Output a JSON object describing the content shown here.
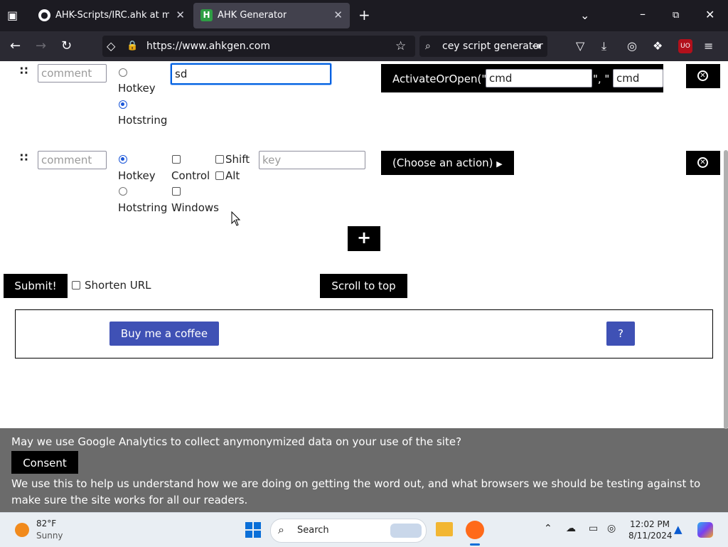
{
  "browser": {
    "tabs": [
      {
        "title": "AHK-Scripts/IRC.ahk at master",
        "favicon": "github-icon",
        "active": false
      },
      {
        "title": "AHK Generator",
        "favicon": "H",
        "active": true
      }
    ],
    "url": "https://www.ahkgen.com",
    "search_text": "cey script generator"
  },
  "rows": [
    {
      "comment_placeholder": "comment",
      "trigger_options": [
        "Hotkey",
        "Hotstring"
      ],
      "selected_trigger": "Hotstring",
      "hotstring_value": "sd",
      "action_label": "ActivateOrOpen(\"",
      "action_arg1": "cmd",
      "action_sep": "\", \"",
      "action_arg2": "cmd"
    },
    {
      "comment_placeholder": "comment",
      "trigger_options": [
        "Hotkey",
        "Hotstring"
      ],
      "selected_trigger": "Hotkey",
      "modifiers": [
        "Control",
        "Windows",
        "Shift",
        "Alt"
      ],
      "key_placeholder": "key",
      "action_button": "(Choose an action)"
    }
  ],
  "add_button": "+",
  "submit_button": "Submit!",
  "shorten_url_label": "Shorten URL",
  "scroll_top_button": "Scroll to top",
  "coffee_button": "Buy me a coffee",
  "help_button": "?",
  "consent": {
    "question": "May we use Google Analytics to collect anymonymized data on your use of the site?",
    "button": "Consent",
    "explanation": "We use this to help us understand how we are doing on getting the word out, and what browsers we should be testing against to make sure the site works for all our readers."
  },
  "taskbar": {
    "weather_temp": "82°F",
    "weather_desc": "Sunny",
    "search_placeholder": "Search",
    "time": "12:02 PM",
    "date": "8/11/2024"
  },
  "colors": {
    "accent_blue": "#3f51b5",
    "chrome_dark": "#1c1b22",
    "consent_gray": "#6b6b6b"
  }
}
